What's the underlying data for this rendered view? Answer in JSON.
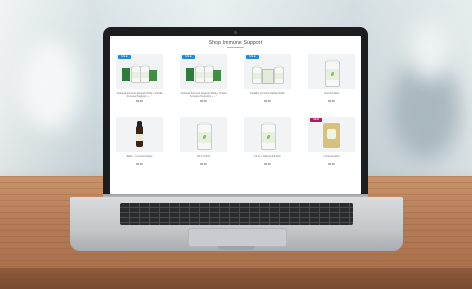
{
  "page": {
    "title": "Shop Immune Support"
  },
  "products": [
    {
      "name": "\"Optimal Immune Support Pack + Kinder Immune Support + ...\"",
      "price": "$0.00",
      "badge": "SALE",
      "badge_color": "#1e88e5",
      "kind": "bundle"
    },
    {
      "name": "\"Optimal Immune Support Pack + Power Immune Immunity + ...\"",
      "price": "$0.00",
      "badge": "SALE",
      "badge_color": "#1e88e5",
      "kind": "bundle"
    },
    {
      "name": "\"Healthy Immune Starter Pack\"",
      "price": "$0.00",
      "badge": "SALE",
      "badge_color": "#1e88e5",
      "kind": "trio"
    },
    {
      "name": "Immune Max",
      "price": "$0.00",
      "badge": "",
      "badge_color": "",
      "kind": "bottle"
    },
    {
      "name": "Elder... Immune Drops",
      "price": "$0.00",
      "badge": "",
      "badge_color": "",
      "kind": "dropper"
    },
    {
      "name": "Vit C Citrus",
      "price": "$0.00",
      "badge": "",
      "badge_color": "",
      "kind": "bottle"
    },
    {
      "name": "Vit D + Vitamin K2 Zinc",
      "price": "$0.00",
      "badge": "",
      "badge_color": "",
      "kind": "bottle"
    },
    {
      "name": "Immune Flora",
      "price": "$0.00",
      "badge": "NEW",
      "badge_color": "#b0185e",
      "kind": "pouch"
    }
  ],
  "colors": {
    "accent_rule": "#d9b25a",
    "sale_badge": "#1e88e5",
    "new_badge": "#b0185e"
  }
}
